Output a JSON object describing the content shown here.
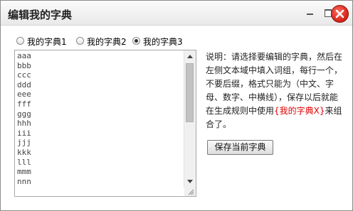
{
  "window": {
    "title": "编辑我的字典"
  },
  "radios": [
    {
      "label": "我的字典1",
      "checked": false
    },
    {
      "label": "我的字典2",
      "checked": false
    },
    {
      "label": "我的字典3",
      "checked": true
    }
  ],
  "dictionary": {
    "lines": [
      "aaa",
      "bbb",
      "ccc",
      "ddd",
      "eee",
      "fff",
      "ggg",
      "hhh",
      "iii",
      "jjj",
      "kkk",
      "lll",
      "mmm",
      "nnn"
    ]
  },
  "description": {
    "text": "说明：请选择要编辑的字典，然后在左侧文本域中填入词组，每行一个，不要后缀，格式只能为（中文、字母、数字、中横线），保存以后就能在生成规则中使用",
    "highlight": "{我的字典X}",
    "suffix": "来组合了。",
    "highlight_color": "#e00000"
  },
  "buttons": {
    "save": "保存当前字典"
  }
}
